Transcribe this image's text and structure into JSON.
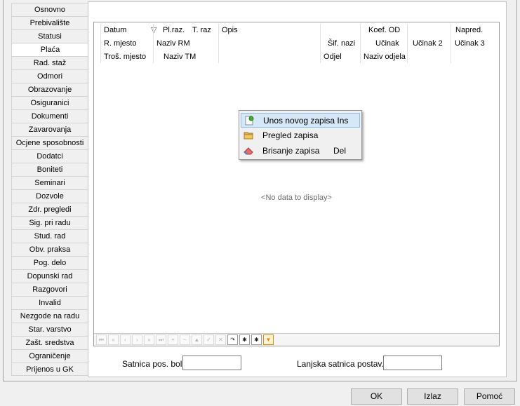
{
  "tabs": [
    "Osnovno",
    "Prebivalište",
    "Statusi",
    "Plaća",
    "Rad. staž",
    "Odmori",
    "Obrazovanje",
    "Osiguranici",
    "Dokumenti",
    "Zavarovanja",
    "Ocjene sposobnosti",
    "Dodatci",
    "Boniteti",
    "Seminari",
    "Dozvole",
    "Zdr. pregledi",
    "Sig. pri radu",
    "Stud. rad",
    "Obv. praksa",
    "Pog. delo",
    "Dopunski rad",
    "Razgovori",
    "Invalid",
    "Nezgode na radu",
    "Star. varstvo",
    "Zašt. sredstva",
    "Ograničenje",
    "Prijenos u GK"
  ],
  "active_tab": "Plaća",
  "grid": {
    "row1": {
      "datum": "Datum",
      "filter_glyph": "▽",
      "plraz": "Pl.raz.",
      "traz": "T. raz",
      "opis": "Opis",
      "koef": "Koef. OD",
      "napred": "Napred."
    },
    "row2": {
      "rmjesto": "R. mjesto",
      "naziv_rm": "Naziv RM",
      "sif": "Šif. nazi",
      "ucinak": "Učinak",
      "ucinak2": "Učinak 2",
      "ucinak3": "Učinak 3"
    },
    "row3": {
      "trosmjesto": "Troš. mjesto",
      "naziv_tm": "Naziv TM",
      "odjel": "Odjel",
      "naziv_odjela": "Naziv odjela"
    },
    "empty_text": "<No data to display>",
    "nav_glyphs": [
      "⏮",
      "«",
      "‹",
      "›",
      "»",
      "⏭",
      "+",
      "−",
      "▲",
      "✓",
      "✕",
      "↷",
      "✱",
      "✱",
      "▼"
    ]
  },
  "context_menu": [
    {
      "label": "Unos novog zapisa Ins",
      "shortcut": "",
      "icon": "new-record-icon"
    },
    {
      "label": "Pregled zapisa",
      "shortcut": "",
      "icon": "folder-icon"
    },
    {
      "label": "Brisanje zapisa",
      "shortcut": "Del",
      "icon": "eraser-icon"
    }
  ],
  "fields": {
    "satnica_label": "Satnica pos. bol",
    "satnica_value": "",
    "lanjska_label": "Lanjska satnica postav.",
    "lanjska_value": ""
  },
  "buttons": {
    "ok": "OK",
    "izlaz": "Izlaz",
    "pomoc": "Pomoć"
  }
}
